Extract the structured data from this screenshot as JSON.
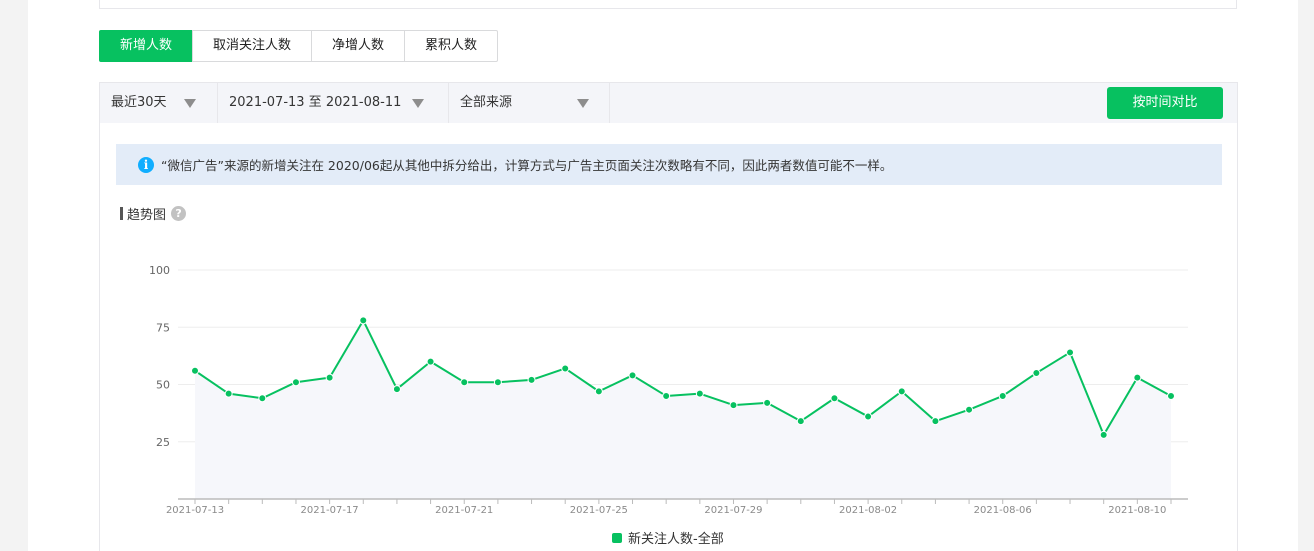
{
  "tabs": [
    {
      "label": "新增人数",
      "active": true
    },
    {
      "label": "取消关注人数",
      "active": false
    },
    {
      "label": "净增人数",
      "active": false
    },
    {
      "label": "累积人数",
      "active": false
    }
  ],
  "filters": {
    "period": "最近30天",
    "date_range": "2021-07-13 至 2021-08-11",
    "source": "全部来源"
  },
  "compare_button": "按时间对比",
  "notice": {
    "icon": "info-icon",
    "text": "“微信广告”来源的新增关注在 2020/06起从其他中拆分给出，计算方式与广告主页面关注次数略有不同，因此两者数值可能不一样。"
  },
  "section": {
    "title": "趋势图",
    "help_icon": "question-icon",
    "help_symbol": "?"
  },
  "colors": {
    "accent": "#07c160",
    "info": "#10aeff"
  },
  "chart_data": {
    "type": "line",
    "y_ticks": [
      "100",
      "75",
      "50",
      "25"
    ],
    "ylim": [
      0,
      100
    ],
    "x_ticks": [
      "2021-07-13",
      "2021-07-17",
      "2021-07-21",
      "2021-07-25",
      "2021-07-29",
      "2021-08-02",
      "2021-08-06",
      "2021-08-10"
    ],
    "x": [
      "2021-07-13",
      "2021-07-14",
      "2021-07-15",
      "2021-07-16",
      "2021-07-17",
      "2021-07-18",
      "2021-07-19",
      "2021-07-20",
      "2021-07-21",
      "2021-07-22",
      "2021-07-23",
      "2021-07-24",
      "2021-07-25",
      "2021-07-26",
      "2021-07-27",
      "2021-07-28",
      "2021-07-29",
      "2021-07-30",
      "2021-07-31",
      "2021-08-01",
      "2021-08-02",
      "2021-08-03",
      "2021-08-04",
      "2021-08-05",
      "2021-08-06",
      "2021-08-07",
      "2021-08-08",
      "2021-08-09",
      "2021-08-10",
      "2021-08-11"
    ],
    "series": [
      {
        "name": "新关注人数-全部",
        "color": "#07c160",
        "values": [
          56,
          46,
          44,
          51,
          53,
          78,
          48,
          60,
          51,
          51,
          52,
          57,
          47,
          54,
          45,
          46,
          41,
          42,
          34,
          44,
          36,
          47,
          34,
          39,
          45,
          55,
          64,
          28,
          53,
          45
        ]
      }
    ],
    "grid": true,
    "legend": "bottom"
  }
}
